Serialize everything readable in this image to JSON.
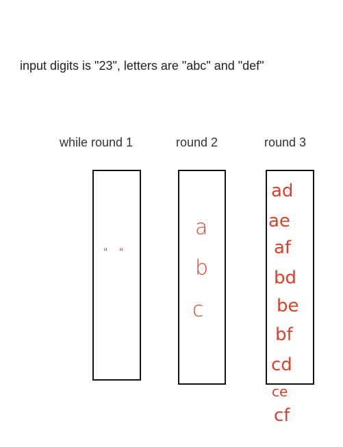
{
  "caption": "input digits is \"23\", letters are \"abc\" and \"def\"",
  "rounds": [
    {
      "label": "while round 1",
      "items": [
        "\" \""
      ]
    },
    {
      "label": "round 2",
      "items": [
        "a",
        "b",
        "c"
      ]
    },
    {
      "label": "round 3",
      "items": [
        "ad",
        "ae",
        "af",
        "bd",
        "be",
        "bf",
        "cd",
        "ce",
        "cf"
      ]
    }
  ],
  "colors": {
    "ink": "#d9422a",
    "box_border": "#111111",
    "text": "#333333"
  }
}
